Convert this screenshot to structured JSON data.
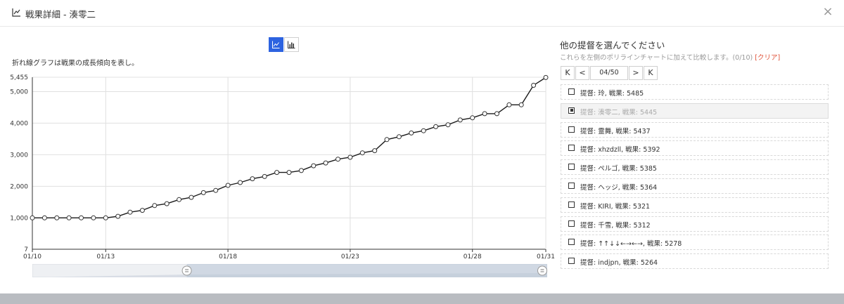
{
  "dialog": {
    "title": "戦果詳細 - 湊零二",
    "close_glyph": "×"
  },
  "chart_toggle": {
    "active": "line",
    "accent": "#2d63e0"
  },
  "chart_note": "折れ線グラフは戦果の成長傾向を表し。",
  "chart_data": {
    "type": "line",
    "title": "",
    "xlabel": "",
    "ylabel": "",
    "x_ticks": [
      "01/10",
      "01/13",
      "01/18",
      "01/23",
      "01/28",
      "01/31"
    ],
    "y_ticks": [
      "7",
      "1,000",
      "2,000",
      "3,000",
      "4,000",
      "5,000",
      "5,455"
    ],
    "ylim": [
      7,
      5455
    ],
    "grid": true,
    "line_color": "#1a1a1a",
    "series": [
      {
        "name": "",
        "x": [
          "01/10",
          "01/10",
          "01/11",
          "01/11",
          "01/12",
          "01/12",
          "01/13",
          "01/13",
          "01/14",
          "01/14",
          "01/15",
          "01/15",
          "01/16",
          "01/16",
          "01/17",
          "01/17",
          "01/18",
          "01/18",
          "01/19",
          "01/19",
          "01/20",
          "01/21",
          "01/21",
          "01/22",
          "01/22",
          "01/23",
          "01/23",
          "01/24",
          "01/24",
          "01/25",
          "01/25",
          "01/26",
          "01/26",
          "01/27",
          "01/27",
          "01/28",
          "01/28",
          "01/29",
          "01/29",
          "01/30",
          "01/30",
          "01/31",
          "01/31"
        ],
        "values": [
          1000,
          1000,
          1000,
          1000,
          1000,
          1000,
          1000,
          1050,
          1180,
          1240,
          1390,
          1450,
          1580,
          1650,
          1800,
          1870,
          2030,
          2120,
          2240,
          2310,
          2440,
          2440,
          2500,
          2650,
          2740,
          2860,
          2920,
          3060,
          3130,
          3480,
          3570,
          3690,
          3760,
          3890,
          3950,
          4100,
          4170,
          4300,
          4300,
          4580,
          4580,
          5200,
          5445
        ]
      }
    ]
  },
  "right_panel": {
    "title": "他の提督を選んでください",
    "subtitle": "これらを左側のポリラインチャートに加えて比較します。(0/10)",
    "clear_label": "[クリア]",
    "pager": {
      "first": "K",
      "prev": "<",
      "info": "04/50",
      "next": ">",
      "last": "K"
    },
    "items": [
      {
        "label": "提督: 玲, 戦果: 5485",
        "selected": false
      },
      {
        "label": "提督: 湊零二, 戦果: 5445",
        "selected": true
      },
      {
        "label": "提督: 霊舞, 戦果: 5437",
        "selected": false
      },
      {
        "label": "提督: xhzdzll, 戦果: 5392",
        "selected": false
      },
      {
        "label": "提督: ペルゴ, 戦果: 5385",
        "selected": false
      },
      {
        "label": "提督: ヘッジ, 戦果: 5364",
        "selected": false
      },
      {
        "label": "提督: KIRI, 戦果: 5321",
        "selected": false
      },
      {
        "label": "提督: 千雪, 戦果: 5312",
        "selected": false
      },
      {
        "label": "提督: ↑↑↓↓←→←→, 戦果: 5278",
        "selected": false
      },
      {
        "label": "提督: indjpn, 戦果: 5264",
        "selected": false
      }
    ]
  },
  "range_slider": {
    "start_fraction": 0.3,
    "end_fraction": 1.0
  }
}
